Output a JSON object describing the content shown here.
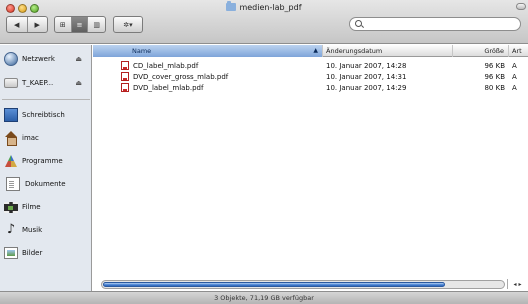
{
  "window": {
    "title": "medien-lab_pdf"
  },
  "toolbar": {
    "back": "◀",
    "forward": "▶",
    "view_icons": "⊞",
    "view_list": "≡",
    "view_columns": "▥",
    "action": "✲▾"
  },
  "search": {
    "placeholder": ""
  },
  "sidebar": {
    "items": [
      {
        "label": "Netzwerk",
        "icon": "globe-icon",
        "eject": "⏏"
      },
      {
        "label": "T_KAEP...",
        "icon": "drive-icon",
        "eject": "⏏"
      },
      {
        "label": "Schreibtisch",
        "icon": "desktop-icon"
      },
      {
        "label": "imac",
        "icon": "home-icon"
      },
      {
        "label": "Programme",
        "icon": "applications-icon"
      },
      {
        "label": "Dokumente",
        "icon": "document-icon"
      },
      {
        "label": "Filme",
        "icon": "film-icon"
      },
      {
        "label": "Musik",
        "icon": "music-icon"
      },
      {
        "label": "Bilder",
        "icon": "pictures-icon"
      }
    ]
  },
  "list": {
    "columns": {
      "name": "Name",
      "modified": "Änderungsdatum",
      "size": "Größe",
      "kind": "Art"
    },
    "sort_arrow": "▲",
    "rows": [
      {
        "name": "CD_label_mlab.pdf",
        "modified": "10. Januar 2007, 14:28",
        "size": "96 KB",
        "kind": "A"
      },
      {
        "name": "DVD_cover_gross_mlab.pdf",
        "modified": "10. Januar 2007, 14:31",
        "size": "96 KB",
        "kind": "A"
      },
      {
        "name": "DVD_label_mlab.pdf",
        "modified": "10. Januar 2007, 14:29",
        "size": "80 KB",
        "kind": "A"
      }
    ]
  },
  "scroll": {
    "visible_fraction": 0.86,
    "arrows": "◂ ▸"
  },
  "status": {
    "text": "3 Objekte, 71,19 GB verfügbar"
  }
}
